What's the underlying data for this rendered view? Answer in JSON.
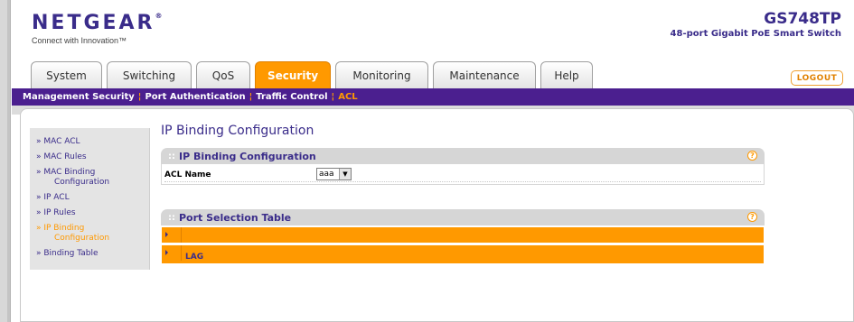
{
  "brand": {
    "logo": "NETGEAR",
    "tagline": "Connect with Innovation™"
  },
  "device": {
    "model": "GS748TP",
    "description": "48-port Gigabit PoE Smart Switch"
  },
  "tabs": [
    {
      "label": "System"
    },
    {
      "label": "Switching"
    },
    {
      "label": "QoS"
    },
    {
      "label": "Security"
    },
    {
      "label": "Monitoring"
    },
    {
      "label": "Maintenance"
    },
    {
      "label": "Help"
    }
  ],
  "logout_label": "LOGOUT",
  "subnav": [
    {
      "label": "Management Security"
    },
    {
      "label": "Port Authentication"
    },
    {
      "label": "Traffic Control"
    },
    {
      "label": "ACL"
    }
  ],
  "sidebar": [
    {
      "label": "» MAC ACL"
    },
    {
      "label": "» MAC Rules"
    },
    {
      "label": "» MAC Binding",
      "cont": "Configuration"
    },
    {
      "label": "» IP ACL"
    },
    {
      "label": "» IP Rules"
    },
    {
      "label": "» IP Binding",
      "cont": "Configuration"
    },
    {
      "label": "» Binding Table"
    }
  ],
  "page_title": "IP Binding Configuration",
  "binding_panel": {
    "title": "IP Binding Configuration",
    "acl_label": "ACL Name",
    "acl_value": "aaa"
  },
  "port_panel": {
    "title": "Port Selection Table",
    "rows": [
      {
        "label": ""
      },
      {
        "label": "LAG"
      }
    ]
  },
  "colors": {
    "accent": "#ff9900",
    "brand": "#3a2c8a",
    "subnav": "#4b1f8f"
  }
}
